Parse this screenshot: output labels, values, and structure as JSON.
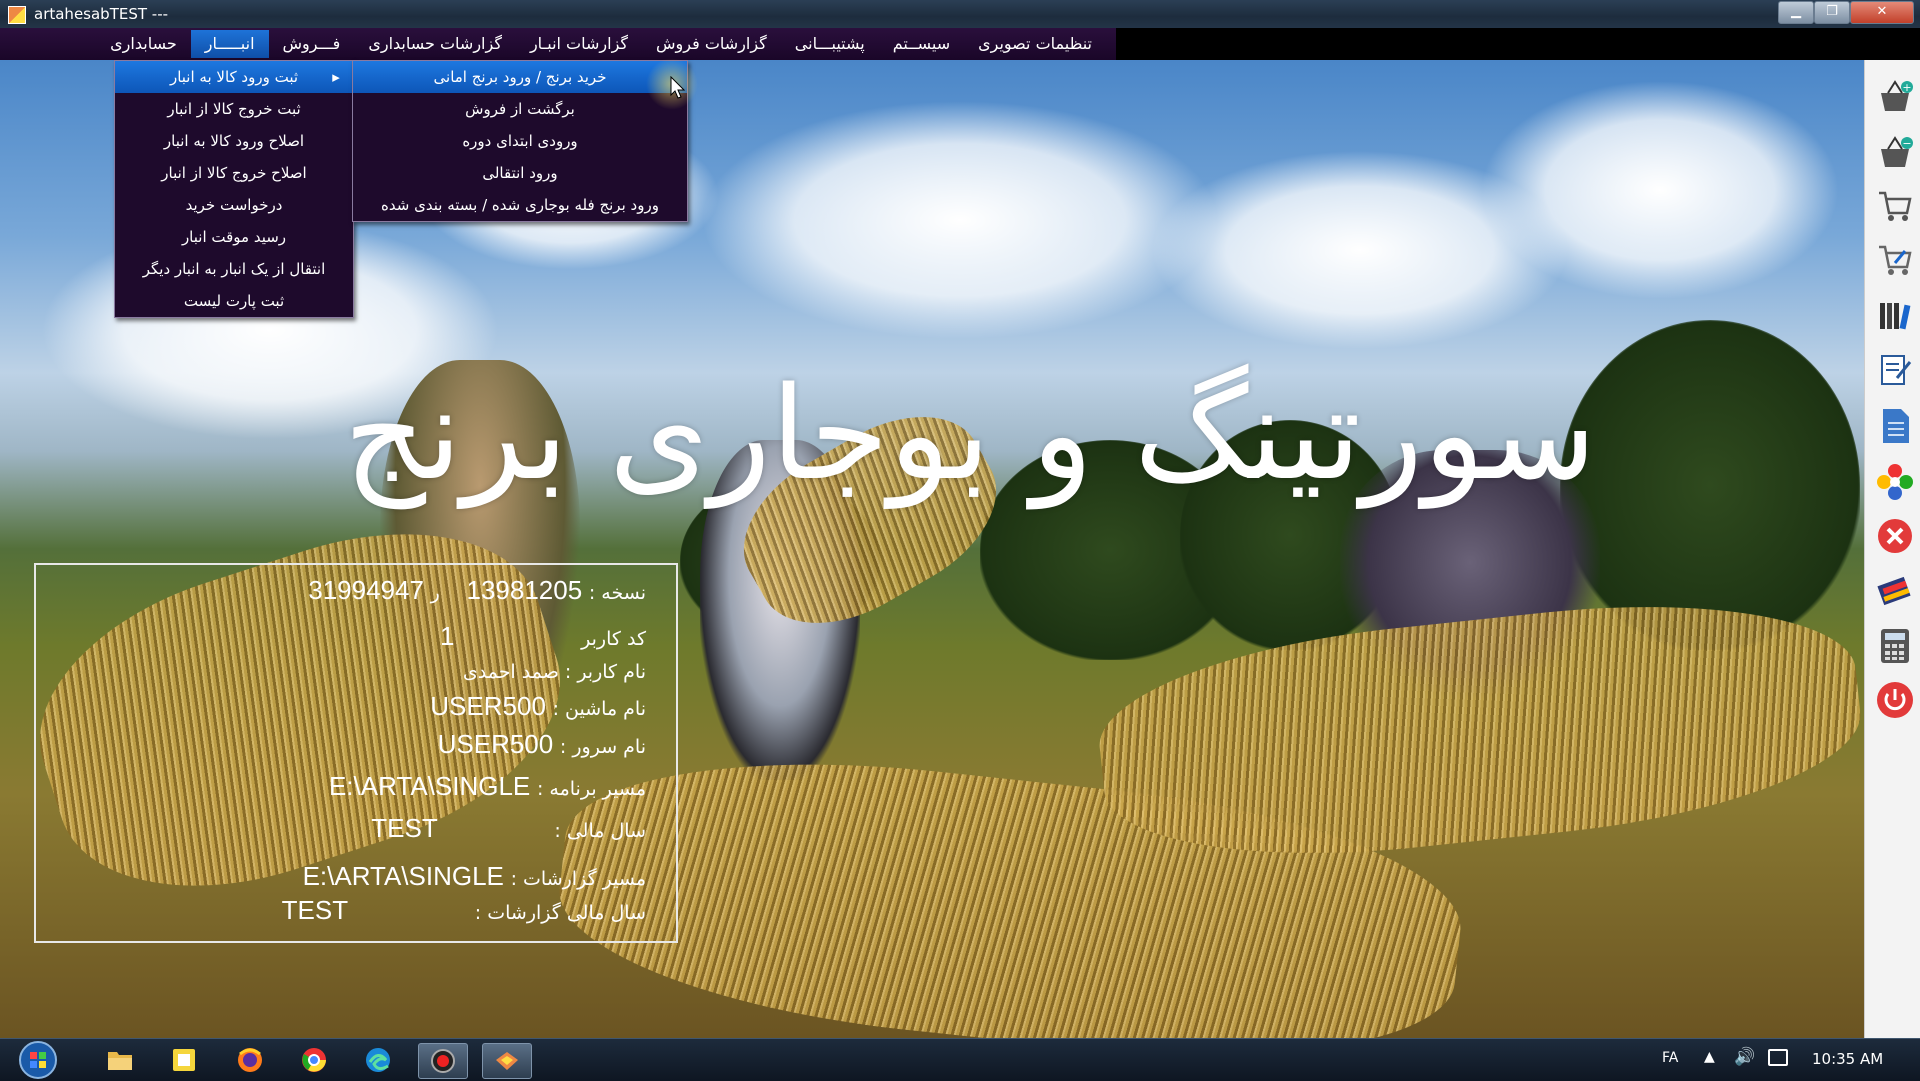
{
  "window": {
    "title": "artahesabTEST ---"
  },
  "window_buttons": {
    "minimize": "▁",
    "restore": "❐",
    "close": "✕"
  },
  "menubar": {
    "items": [
      {
        "label": "حسابداری"
      },
      {
        "label": "انبـــــار"
      },
      {
        "label": "فـــروش"
      },
      {
        "label": "گزارشات حسابداری"
      },
      {
        "label": "گزارشات انبـار"
      },
      {
        "label": "گزارشات فروش"
      },
      {
        "label": "پشتیبـــانی"
      },
      {
        "label": "سیســتم"
      },
      {
        "label": "تنظیمات تصویری"
      }
    ]
  },
  "warehouse_menu": {
    "items": [
      {
        "label": "ثبت ورود کالا به انبار",
        "has_submenu": true
      },
      {
        "label": "ثبت خروج کالا از انبار"
      },
      {
        "label": "اصلاح ورود کالا به انبار"
      },
      {
        "label": "اصلاح خروج کالا از انبار"
      },
      {
        "label": "درخواست خرید"
      },
      {
        "label": "رسید موقت انبار"
      },
      {
        "label": "انتقال از یک انبار به انبار دیگر"
      },
      {
        "label": "ثبت پارت لیست"
      }
    ]
  },
  "entry_submenu": {
    "items": [
      {
        "label": "خرید برنج / ورود برنج امانی"
      },
      {
        "label": "برگشت از فروش"
      },
      {
        "label": "ورودی ابتدای دوره"
      },
      {
        "label": "ورود انتقالی"
      },
      {
        "label": "ورود برنج فله بوجاری شده / بسته بندی شده"
      }
    ]
  },
  "banner": {
    "title": "سورتینگ و بوجاری برنج"
  },
  "info": {
    "version_label": "نسخه :",
    "version_value": "13981205",
    "serial_label": "ر",
    "serial_value": "31994947",
    "user_code_label": "کد کاربر",
    "user_code_value": "1",
    "user_name": "نام کاربر : صمد احمدی",
    "machine_label": "نام ماشین :",
    "machine_value": "USER500",
    "server_label": "نام سرور :",
    "server_value": "USER500",
    "path_label": "مسیر برنامه :",
    "path_value": "E:\\ARTA\\SINGLE",
    "fiscal_label": "سال مالی :",
    "fiscal_value": "TEST",
    "report_path_label": "مسیر گزارشات :",
    "report_path_value": "E:\\ARTA\\SINGLE",
    "report_fiscal_label": "سال مالی گزارشات :",
    "report_fiscal_value": "TEST"
  },
  "toolbar_icons": [
    "basket-add-icon",
    "basket-remove-icon",
    "cart-icon",
    "cart-edit-icon",
    "books-icon",
    "edit-document-icon",
    "document-icon",
    "colorful-flower-icon",
    "red-close-icon",
    "pen-tools-icon",
    "calculator-icon",
    "power-icon"
  ],
  "taskbar": {
    "language": "FA",
    "clock": "10:35 AM",
    "apps": [
      "start-orb-icon",
      "file-explorer-icon",
      "sticky-notes-icon",
      "firefox-icon",
      "chrome-icon",
      "edge-icon",
      "record-icon",
      "arta-app-icon"
    ]
  },
  "colors": {
    "menubar_bg": "#1a0628",
    "menu_highlight": "#1565c8",
    "toolbar_bg": "#f3f3f3",
    "taskbar_bg": "#0e1622"
  }
}
